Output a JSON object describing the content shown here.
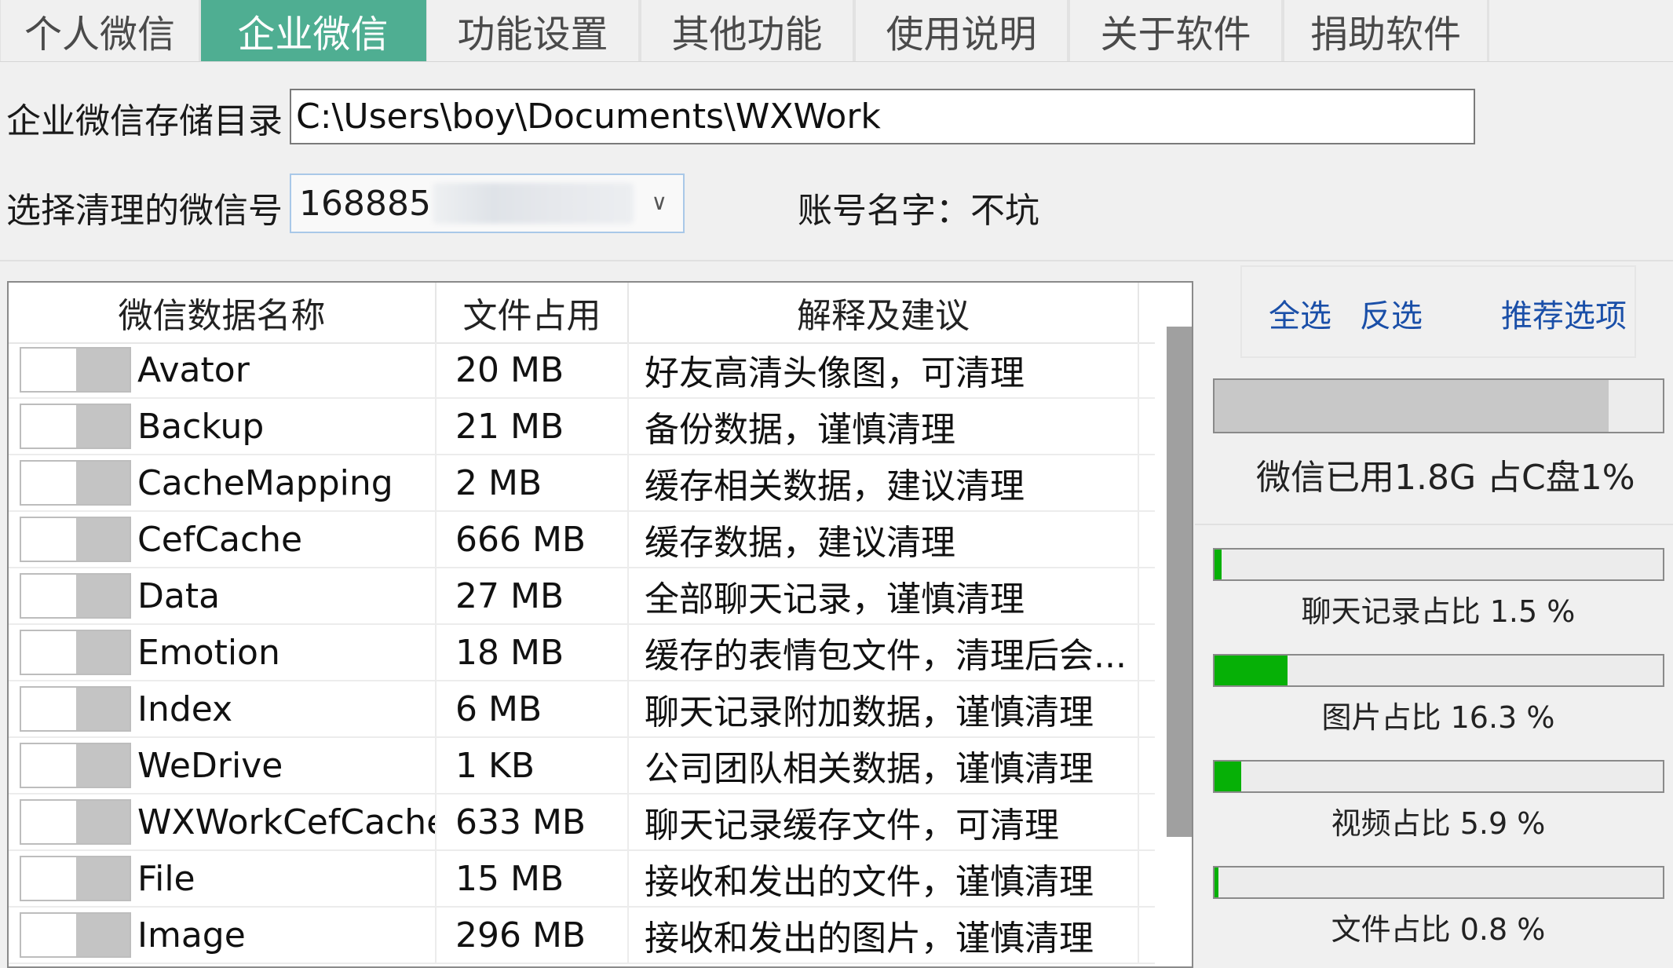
{
  "tabs": [
    {
      "label": "个人微信",
      "active": false
    },
    {
      "label": "企业微信",
      "active": true
    },
    {
      "label": "功能设置",
      "active": false
    },
    {
      "label": "其他功能",
      "active": false
    },
    {
      "label": "使用说明",
      "active": false
    },
    {
      "label": "关于软件",
      "active": false
    },
    {
      "label": "捐助软件",
      "active": false
    }
  ],
  "form": {
    "dir_label": "企业微信存储目录",
    "dir_value": "C:\\Users\\boy\\Documents\\WXWork",
    "account_label": "选择清理的微信号",
    "account_value": "168885",
    "account_name": "账号名字：不坑"
  },
  "table": {
    "headers": [
      "微信数据名称",
      "文件占用",
      "解释及建议"
    ],
    "rows": [
      {
        "name": "Avator",
        "size": "20 MB",
        "note": "好友高清头像图，可清理"
      },
      {
        "name": "Backup",
        "size": "21 MB",
        "note": "备份数据，谨慎清理"
      },
      {
        "name": "CacheMapping",
        "size": "2 MB",
        "note": "缓存相关数据，建议清理"
      },
      {
        "name": "CefCache",
        "size": "666 MB",
        "note": "缓存数据，建议清理"
      },
      {
        "name": "Data",
        "size": "27 MB",
        "note": "全部聊天记录，谨慎清理"
      },
      {
        "name": "Emotion",
        "size": "18 MB",
        "note": "缓存的表情包文件，清理后会..."
      },
      {
        "name": "Index",
        "size": "6 MB",
        "note": "聊天记录附加数据，谨慎清理"
      },
      {
        "name": "WeDrive",
        "size": "1 KB",
        "note": "公司团队相关数据，谨慎清理"
      },
      {
        "name": "WXWorkCefCache",
        "size": "633 MB",
        "note": "聊天记录缓存文件，可清理"
      },
      {
        "name": "File",
        "size": "15 MB",
        "note": "接收和发出的文件，谨慎清理"
      },
      {
        "name": "Image",
        "size": "296 MB",
        "note": "接收和发出的图片，谨慎清理"
      }
    ]
  },
  "actions": {
    "select_all": "全选",
    "invert": "反选",
    "recommend": "推荐选项"
  },
  "usage": {
    "total_text": "微信已用1.8G",
    "disk_text": "占C盘1%",
    "total_fill": 0.88,
    "bar_color": "#c8c8c8"
  },
  "ratios": [
    {
      "label": "聊天记录占比 1.5 %",
      "value": 0.015
    },
    {
      "label": "图片占比 16.3 %",
      "value": 0.163
    },
    {
      "label": "视频占比 5.9 %",
      "value": 0.059
    },
    {
      "label": "文件占比 0.8 %",
      "value": 0.008
    }
  ],
  "colors": {
    "accent": "#4fae92",
    "progress": "#06b006",
    "link": "#1a4fa8"
  }
}
